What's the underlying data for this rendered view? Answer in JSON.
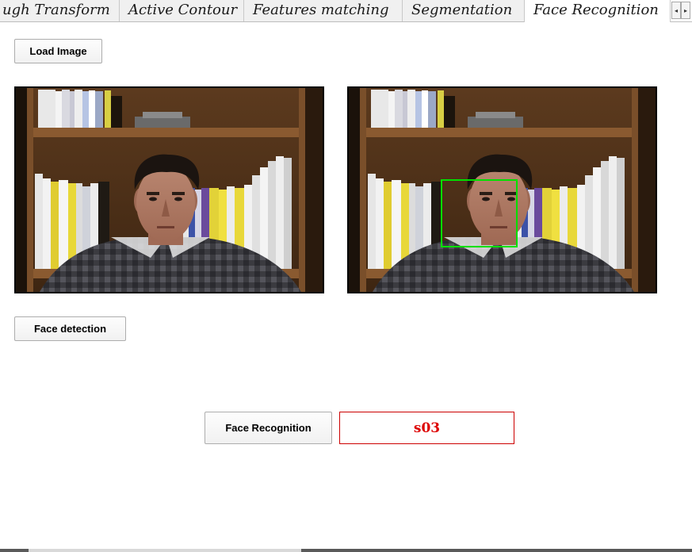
{
  "tabs": [
    {
      "label": "ugh Transform",
      "active": false
    },
    {
      "label": "Active Contour",
      "active": false
    },
    {
      "label": "Features matching",
      "active": false
    },
    {
      "label": "Segmentation",
      "active": false
    },
    {
      "label": "Face Recognition",
      "active": true
    }
  ],
  "tab_scroll": {
    "left_arrow": "◂",
    "right_arrow": "▸"
  },
  "buttons": {
    "load_image": "Load Image",
    "face_detection": "Face detection",
    "face_recognition": "Face Recognition"
  },
  "images": {
    "input": {
      "icon": "portrait-photo"
    },
    "output": {
      "icon": "portrait-photo-with-face-box",
      "detection_box_color": "#00e000"
    }
  },
  "result": {
    "value": "s03",
    "color": "#dd0000",
    "border_color": "#cc0000"
  }
}
